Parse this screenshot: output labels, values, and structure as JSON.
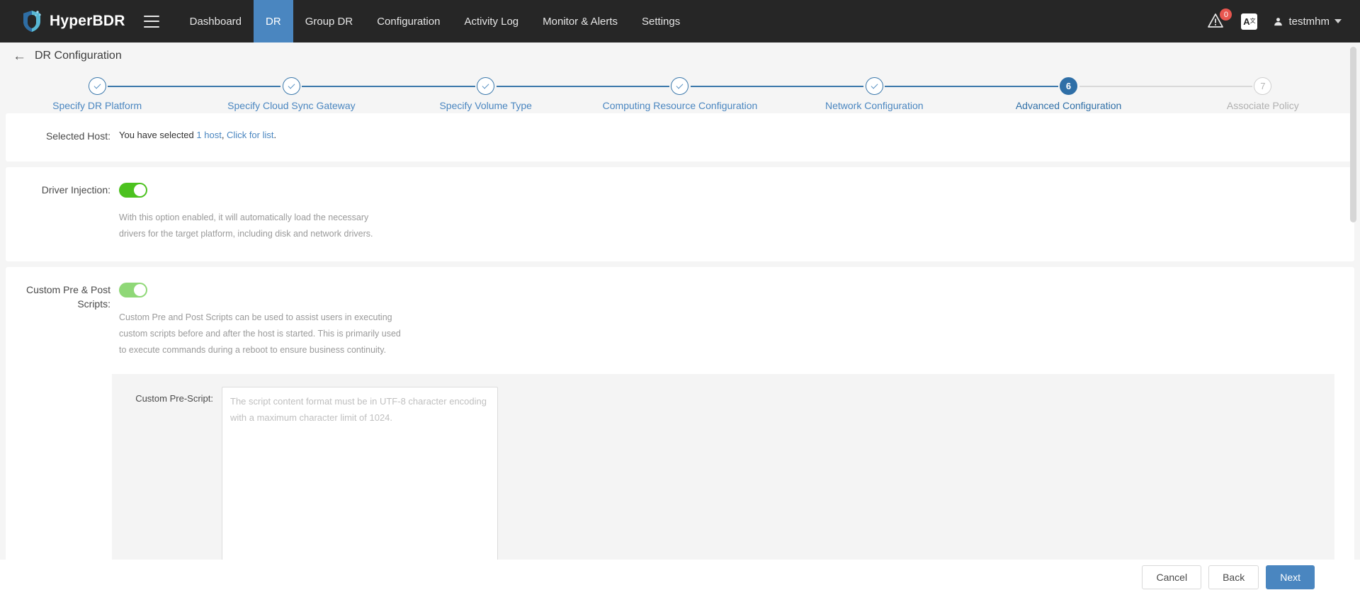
{
  "navbar": {
    "brand": "HyperBDR",
    "menu_icon": "hamburger-icon",
    "links": [
      {
        "label": "Dashboard",
        "active": false
      },
      {
        "label": "DR",
        "active": true
      },
      {
        "label": "Group DR",
        "active": false
      },
      {
        "label": "Configuration",
        "active": false
      },
      {
        "label": "Activity Log",
        "active": false
      },
      {
        "label": "Monitor & Alerts",
        "active": false
      },
      {
        "label": "Settings",
        "active": false
      }
    ],
    "alert_badge": "0",
    "lang_label": "A",
    "lang_sup": "文",
    "user_name": "testmhm"
  },
  "page": {
    "back_arrow": "←",
    "title": "DR Configuration"
  },
  "stepper": {
    "steps": [
      {
        "num": "1",
        "label": "Specify DR Platform",
        "state": "done"
      },
      {
        "num": "2",
        "label": "Specify Cloud Sync Gateway",
        "state": "done"
      },
      {
        "num": "3",
        "label": "Specify Volume Type",
        "state": "done"
      },
      {
        "num": "4",
        "label": "Computing Resource Configuration",
        "state": "done"
      },
      {
        "num": "5",
        "label": "Network Configuration",
        "state": "done"
      },
      {
        "num": "6",
        "label": "Advanced Configuration",
        "state": "current"
      },
      {
        "num": "7",
        "label": "Associate Policy",
        "state": "pending"
      }
    ]
  },
  "selected_host": {
    "label": "Selected Host:",
    "text_prefix": "You have selected ",
    "count": "1 host",
    "text_mid": ", ",
    "link": "Click for list",
    "text_suffix": "."
  },
  "driver_injection": {
    "label": "Driver Injection:",
    "toggle_state": "on",
    "description": "With this option enabled, it will automatically load the necessary drivers for the target platform, including disk and network drivers."
  },
  "custom_scripts": {
    "label_line1": "Custom Pre & Post",
    "label_line2": "Scripts:",
    "toggle_state": "on",
    "description": "Custom Pre and Post Scripts can be used to assist users in executing custom scripts before and after the host is started. This is primarily used to execute commands during a reboot to ensure business continuity.",
    "pre_script": {
      "label": "Custom Pre-Script:",
      "value": "",
      "placeholder": "The script content format must be in UTF-8 character encoding with a maximum character limit of 1024."
    }
  },
  "footer": {
    "cancel": "Cancel",
    "back": "Back",
    "next": "Next"
  },
  "colors": {
    "accent": "#4a86c0",
    "navbar_bg": "#262626",
    "toggle_on": "#4cc21f",
    "toggle_pale": "#8fd877",
    "badge": "#e8564f",
    "step_done": "#4a86c0",
    "step_current": "#2f6fa7",
    "step_pending": "#b0b0b0"
  }
}
